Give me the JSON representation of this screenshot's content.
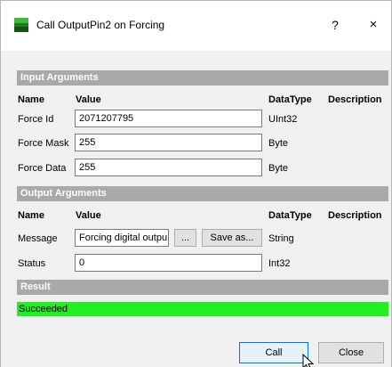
{
  "window": {
    "title": "Call OutputPin2 on Forcing",
    "help_label": "?",
    "close_label": "×"
  },
  "input_arguments": {
    "section_label": "Input Arguments",
    "headers": {
      "name": "Name",
      "value": "Value",
      "datatype": "DataType",
      "description": "Description"
    },
    "rows": [
      {
        "name": "Force Id",
        "value": "2071207795",
        "datatype": "UInt32"
      },
      {
        "name": "Force Mask",
        "value": "255",
        "datatype": "Byte"
      },
      {
        "name": "Force Data",
        "value": "255",
        "datatype": "Byte"
      }
    ]
  },
  "output_arguments": {
    "section_label": "Output Arguments",
    "headers": {
      "name": "Name",
      "value": "Value",
      "datatype": "DataType",
      "description": "Description"
    },
    "rows": [
      {
        "name": "Message",
        "value": "Forcing digital outpu",
        "browse_label": "...",
        "save_label": "Save as...",
        "datatype": "String"
      },
      {
        "name": "Status",
        "value": "0",
        "datatype": "Int32"
      }
    ]
  },
  "result": {
    "section_label": "Result",
    "value": "Succeeded",
    "color": "#22ee22"
  },
  "buttons": {
    "call_label": "Call",
    "close_label": "Close"
  },
  "icons": {
    "app": "app-icon",
    "cursor": "mouse-pointer-icon"
  }
}
